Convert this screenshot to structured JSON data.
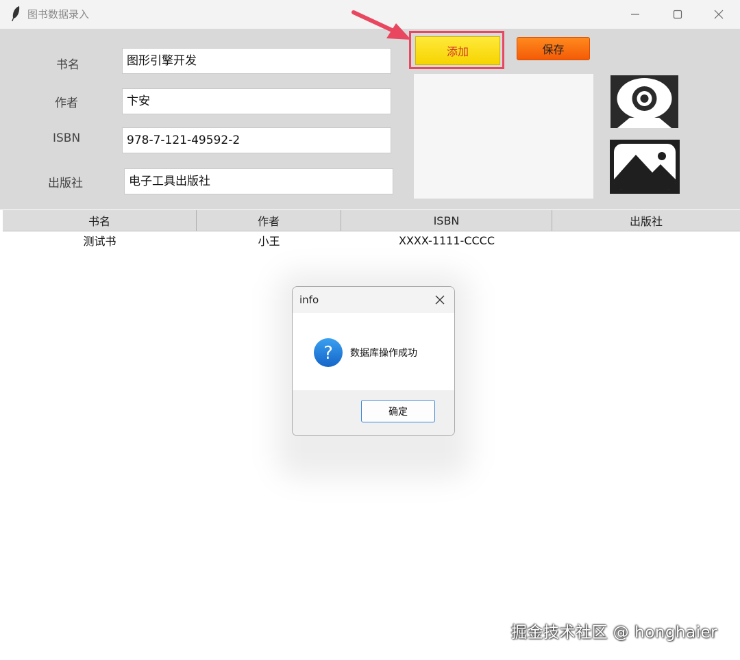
{
  "window": {
    "title": "图书数据录入",
    "controls": {
      "minimize": "minimize-icon",
      "maximize": "maximize-icon",
      "close": "close-icon"
    }
  },
  "form": {
    "fields": [
      {
        "label": "书名",
        "value": "图形引擎开发"
      },
      {
        "label": "作者",
        "value": "卞安"
      },
      {
        "label": "ISBN",
        "value": "978-7-121-49592-2"
      },
      {
        "label": "出版社",
        "value": "电子工具出版社"
      }
    ],
    "add_label": "添加",
    "save_label": "保存",
    "icons": [
      "webcam-icon",
      "image-icon"
    ]
  },
  "table": {
    "columns": [
      "书名",
      "作者",
      "ISBN",
      "出版社"
    ],
    "rows": [
      [
        "测试书",
        "小王",
        "XXXX-1111-CCCC",
        ""
      ]
    ]
  },
  "dialog": {
    "title": "info",
    "message": "数据库操作成功",
    "ok_label": "确定",
    "icon": "question-icon"
  },
  "watermark": "掘金技术社区 @ honghaier",
  "colors": {
    "add_button": "#f6d400",
    "add_text": "#d4322e",
    "save_button": "#f45b06",
    "highlight": "#e8475f",
    "form_bg": "#d9d9d9"
  }
}
